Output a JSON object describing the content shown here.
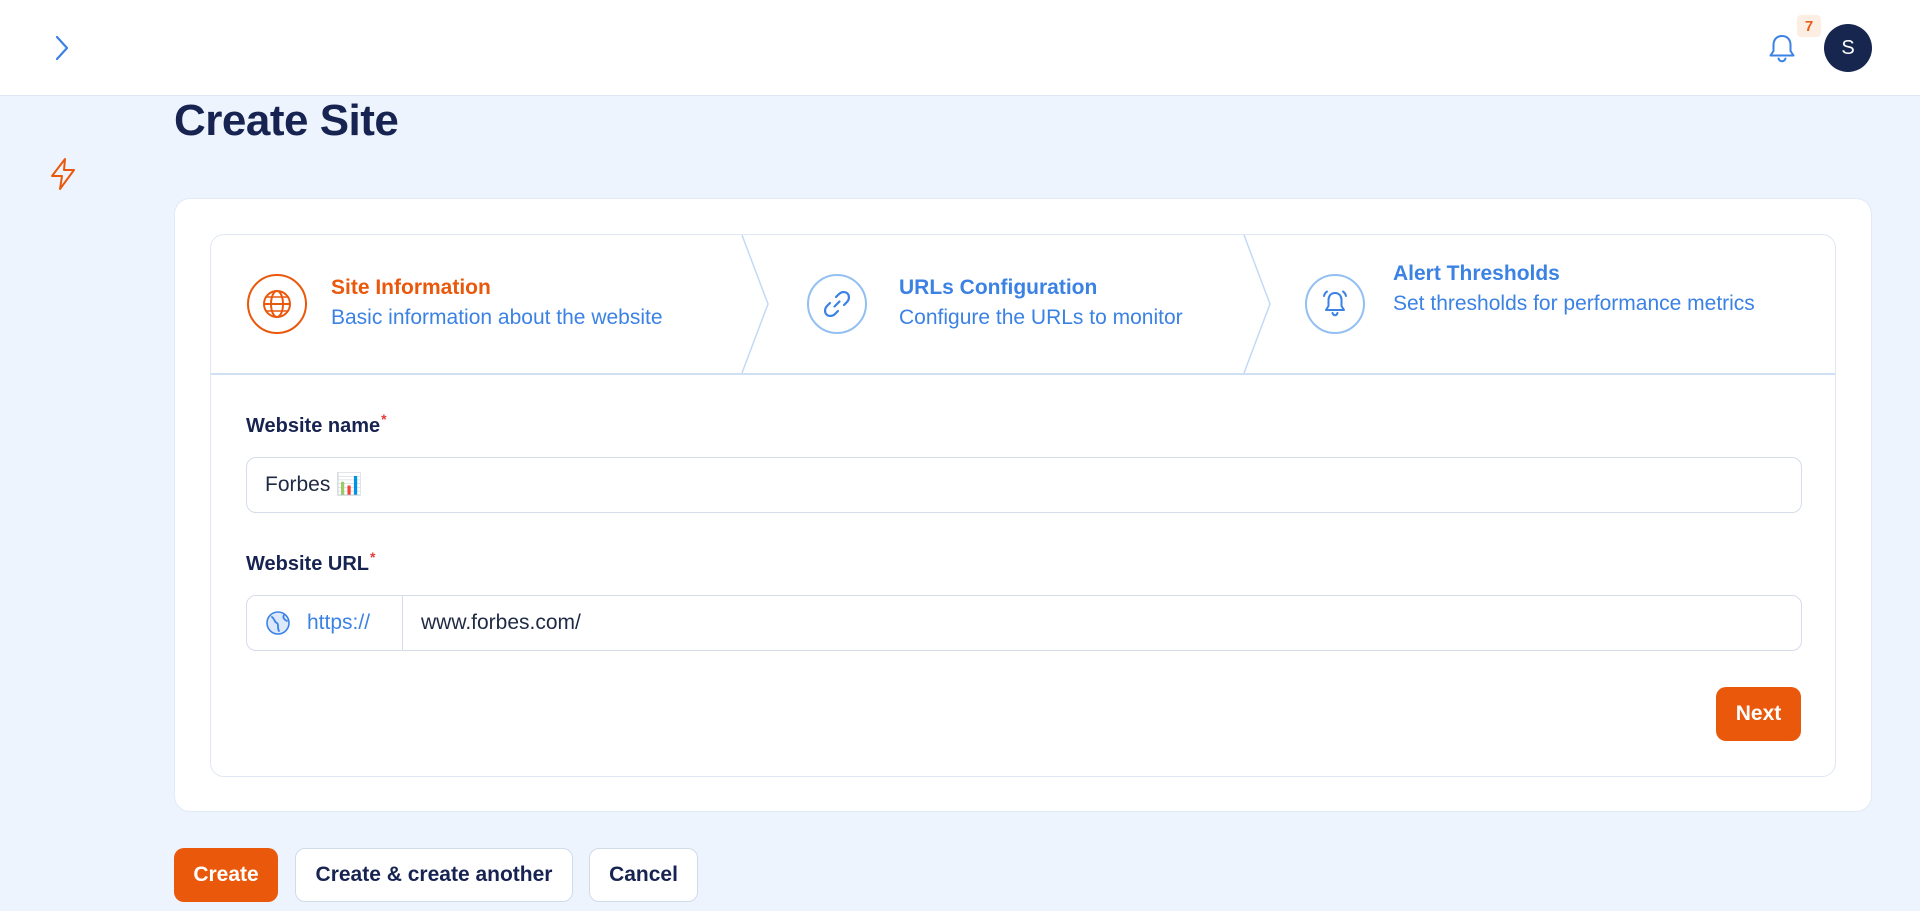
{
  "header": {
    "notification_count": "7",
    "avatar_initial": "S"
  },
  "page": {
    "title": "Create Site"
  },
  "wizard": {
    "steps": [
      {
        "title": "Site Information",
        "description": "Basic information about the website",
        "icon": "globe-icon",
        "state": "active"
      },
      {
        "title": "URLs Configuration",
        "description": "Configure the URLs to monitor",
        "icon": "link-icon",
        "state": "upcoming"
      },
      {
        "title": "Alert Thresholds",
        "description": "Set thresholds for performance metrics",
        "icon": "bell-ring-icon",
        "state": "upcoming"
      }
    ]
  },
  "form": {
    "website_name": {
      "label": "Website name",
      "required_mark": "*",
      "value": "Forbes 📊"
    },
    "website_url": {
      "label": "Website URL",
      "required_mark": "*",
      "prefix": "https://",
      "value": "www.forbes.com/"
    },
    "next_label": "Next"
  },
  "actions": {
    "create_label": "Create",
    "create_another_label": "Create & create another",
    "cancel_label": "Cancel"
  },
  "colors": {
    "accent": "#ea580c",
    "link_blue": "#3b82e4",
    "navy": "#172350",
    "background": "#eef4fd"
  }
}
